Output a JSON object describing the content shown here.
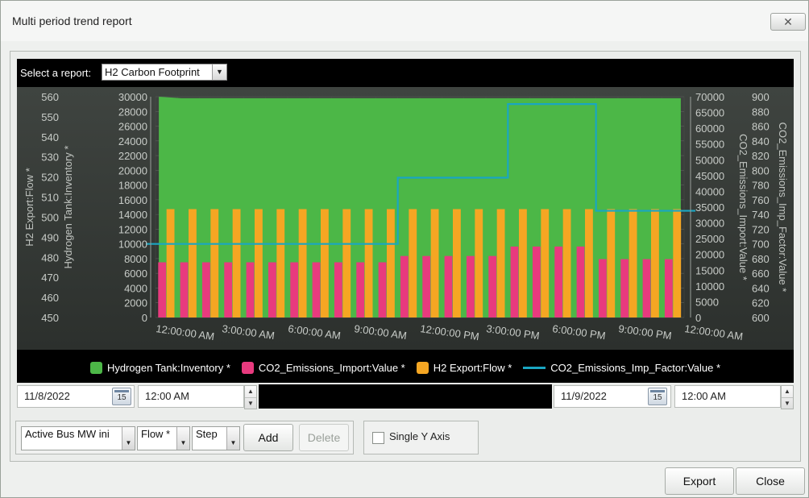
{
  "window": {
    "title": "Multi period trend report",
    "close_glyph": "✕"
  },
  "report": {
    "label": "Select a report:",
    "selected": "H2 Carbon Footprint",
    "arrow_glyph": "▼"
  },
  "chart_data": {
    "type": "bar",
    "x_tick_labels": [
      "12:00:00 AM",
      "3:00:00 AM",
      "6:00:00 AM",
      "9:00:00 AM",
      "12:00:00 PM",
      "3:00:00 PM",
      "6:00:00 PM",
      "9:00:00 PM",
      "12:00:00 AM"
    ],
    "x_hours": [
      0,
      1,
      2,
      3,
      4,
      5,
      6,
      7,
      8,
      9,
      10,
      11,
      12,
      13,
      14,
      15,
      16,
      17,
      18,
      19,
      20,
      21,
      22,
      23
    ],
    "axes": [
      {
        "id": "h2flow",
        "label": "H2 Export:Flow *",
        "min": 450,
        "max": 560,
        "ticks": [
          450,
          460,
          470,
          480,
          490,
          500,
          510,
          520,
          530,
          540,
          550,
          560
        ]
      },
      {
        "id": "inventory",
        "label": "Hydrogen Tank:Inventory *",
        "min": 0,
        "max": 30000,
        "ticks": [
          0,
          2000,
          4000,
          6000,
          8000,
          10000,
          12000,
          14000,
          16000,
          18000,
          20000,
          22000,
          24000,
          26000,
          28000,
          30000
        ]
      },
      {
        "id": "co2import",
        "label": "CO2_Emissions_Import:Value *",
        "min": 0,
        "max": 70000,
        "ticks": [
          0,
          5000,
          10000,
          15000,
          20000,
          25000,
          30000,
          35000,
          40000,
          45000,
          50000,
          55000,
          60000,
          65000,
          70000
        ]
      },
      {
        "id": "co2factor",
        "label": "CO2_Emissions_Imp_Factor:Value *",
        "min": 600,
        "max": 900,
        "ticks": [
          600,
          620,
          640,
          660,
          680,
          700,
          720,
          740,
          760,
          780,
          800,
          820,
          840,
          860,
          880,
          900
        ]
      }
    ],
    "series": [
      {
        "name": "Hydrogen Tank:Inventory *",
        "type": "area",
        "axis": "inventory",
        "color": "#4cb747",
        "values": [
          30000,
          29800,
          29800,
          29800,
          29800,
          29800,
          29800,
          29800,
          29800,
          29800,
          29800,
          29800,
          29800,
          29800,
          29800,
          29800,
          29800,
          29800,
          29800,
          29800,
          29800,
          29800,
          29800,
          29800
        ]
      },
      {
        "name": "CO2_Emissions_Import:Value *",
        "type": "bar",
        "axis": "co2import",
        "color": "#e83a7e",
        "values": [
          17500,
          17500,
          17500,
          17500,
          17500,
          17500,
          17500,
          17500,
          17500,
          17500,
          17500,
          19500,
          19500,
          19500,
          19500,
          19500,
          22500,
          22500,
          22500,
          22500,
          18500,
          18500,
          18500,
          18500
        ]
      },
      {
        "name": "H2 Export:Flow *",
        "type": "bar",
        "axis": "h2flow",
        "color": "#f5a623",
        "values": [
          504,
          504,
          504,
          504,
          504,
          504,
          504,
          504,
          504,
          504,
          504,
          504,
          504,
          504,
          504,
          504,
          504,
          504,
          504,
          504,
          504,
          504,
          504,
          504
        ]
      },
      {
        "name": "CO2_Emissions_Imp_Factor:Value *",
        "type": "step-line",
        "axis": "co2factor",
        "color": "#1aa6c2",
        "values": [
          700,
          700,
          700,
          700,
          700,
          700,
          700,
          700,
          700,
          700,
          700,
          790,
          790,
          790,
          790,
          790,
          890,
          890,
          890,
          890,
          745,
          745,
          745,
          745
        ]
      }
    ],
    "legend_position": "bottom",
    "grid": true
  },
  "range": {
    "start_date": "11/8/2022",
    "start_time": "12:00 AM",
    "end_date": "11/9/2022",
    "end_time": "12:00 AM",
    "calendar_day": "15",
    "spin_up": "▲",
    "spin_down": "▼"
  },
  "controls": {
    "bus_select": "Active Bus MW ini",
    "flow_select": "Flow *",
    "step_select": "Step",
    "combo_arrow": "▼",
    "add_label": "Add",
    "delete_label": "Delete",
    "single_y_label": "Single Y Axis"
  },
  "footer": {
    "export_label": "Export",
    "close_label": "Close"
  }
}
